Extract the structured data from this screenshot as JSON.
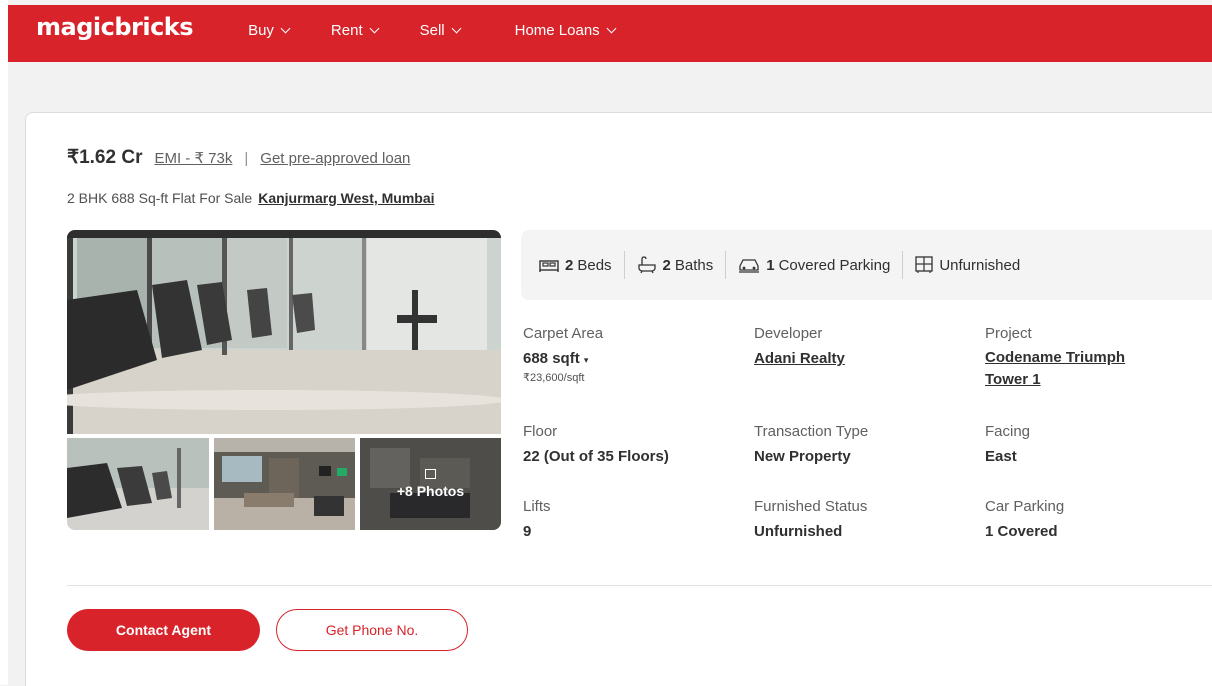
{
  "brand": {
    "logo": "magicbricks",
    "accent": "#d8232a"
  },
  "nav": {
    "items": [
      {
        "label": "Buy"
      },
      {
        "label": "Rent"
      },
      {
        "label": "Sell"
      },
      {
        "label": "Home Loans"
      }
    ]
  },
  "listing": {
    "price": "₹1.62 Cr",
    "emi": "EMI - ₹ 73k",
    "separator": "|",
    "loan_link": "Get pre-approved loan",
    "title": "2 BHK 688 Sq-ft Flat For Sale",
    "locality": "Kanjurmarg West, Mumbai"
  },
  "gallery": {
    "more_photos": "+8 Photos"
  },
  "amenities": [
    {
      "icon": "bed-icon",
      "count": "2",
      "label": "Beds"
    },
    {
      "icon": "bath-icon",
      "count": "2",
      "label": "Baths"
    },
    {
      "icon": "car-icon",
      "count": "1",
      "label": "Covered Parking"
    },
    {
      "icon": "furnish-icon",
      "count": "",
      "label": "Unfurnished"
    }
  ],
  "details": {
    "carpet_area": {
      "label": "Carpet Area",
      "value": "688 sqft",
      "sub": "₹23,600/sqft"
    },
    "developer": {
      "label": "Developer",
      "value": "Adani Realty"
    },
    "project": {
      "label": "Project",
      "value_line1": "Codename Triumph",
      "value_line2": "Tower 1"
    },
    "floor": {
      "label": "Floor",
      "value": "22 (Out of 35 Floors)"
    },
    "transaction": {
      "label": "Transaction Type",
      "value": "New Property"
    },
    "facing": {
      "label": "Facing",
      "value": "East"
    },
    "lifts": {
      "label": "Lifts",
      "value": "9"
    },
    "furnished": {
      "label": "Furnished Status",
      "value": "Unfurnished"
    },
    "car_parking": {
      "label": "Car Parking",
      "value": "1 Covered"
    }
  },
  "actions": {
    "contact": "Contact Agent",
    "phone": "Get Phone No."
  }
}
